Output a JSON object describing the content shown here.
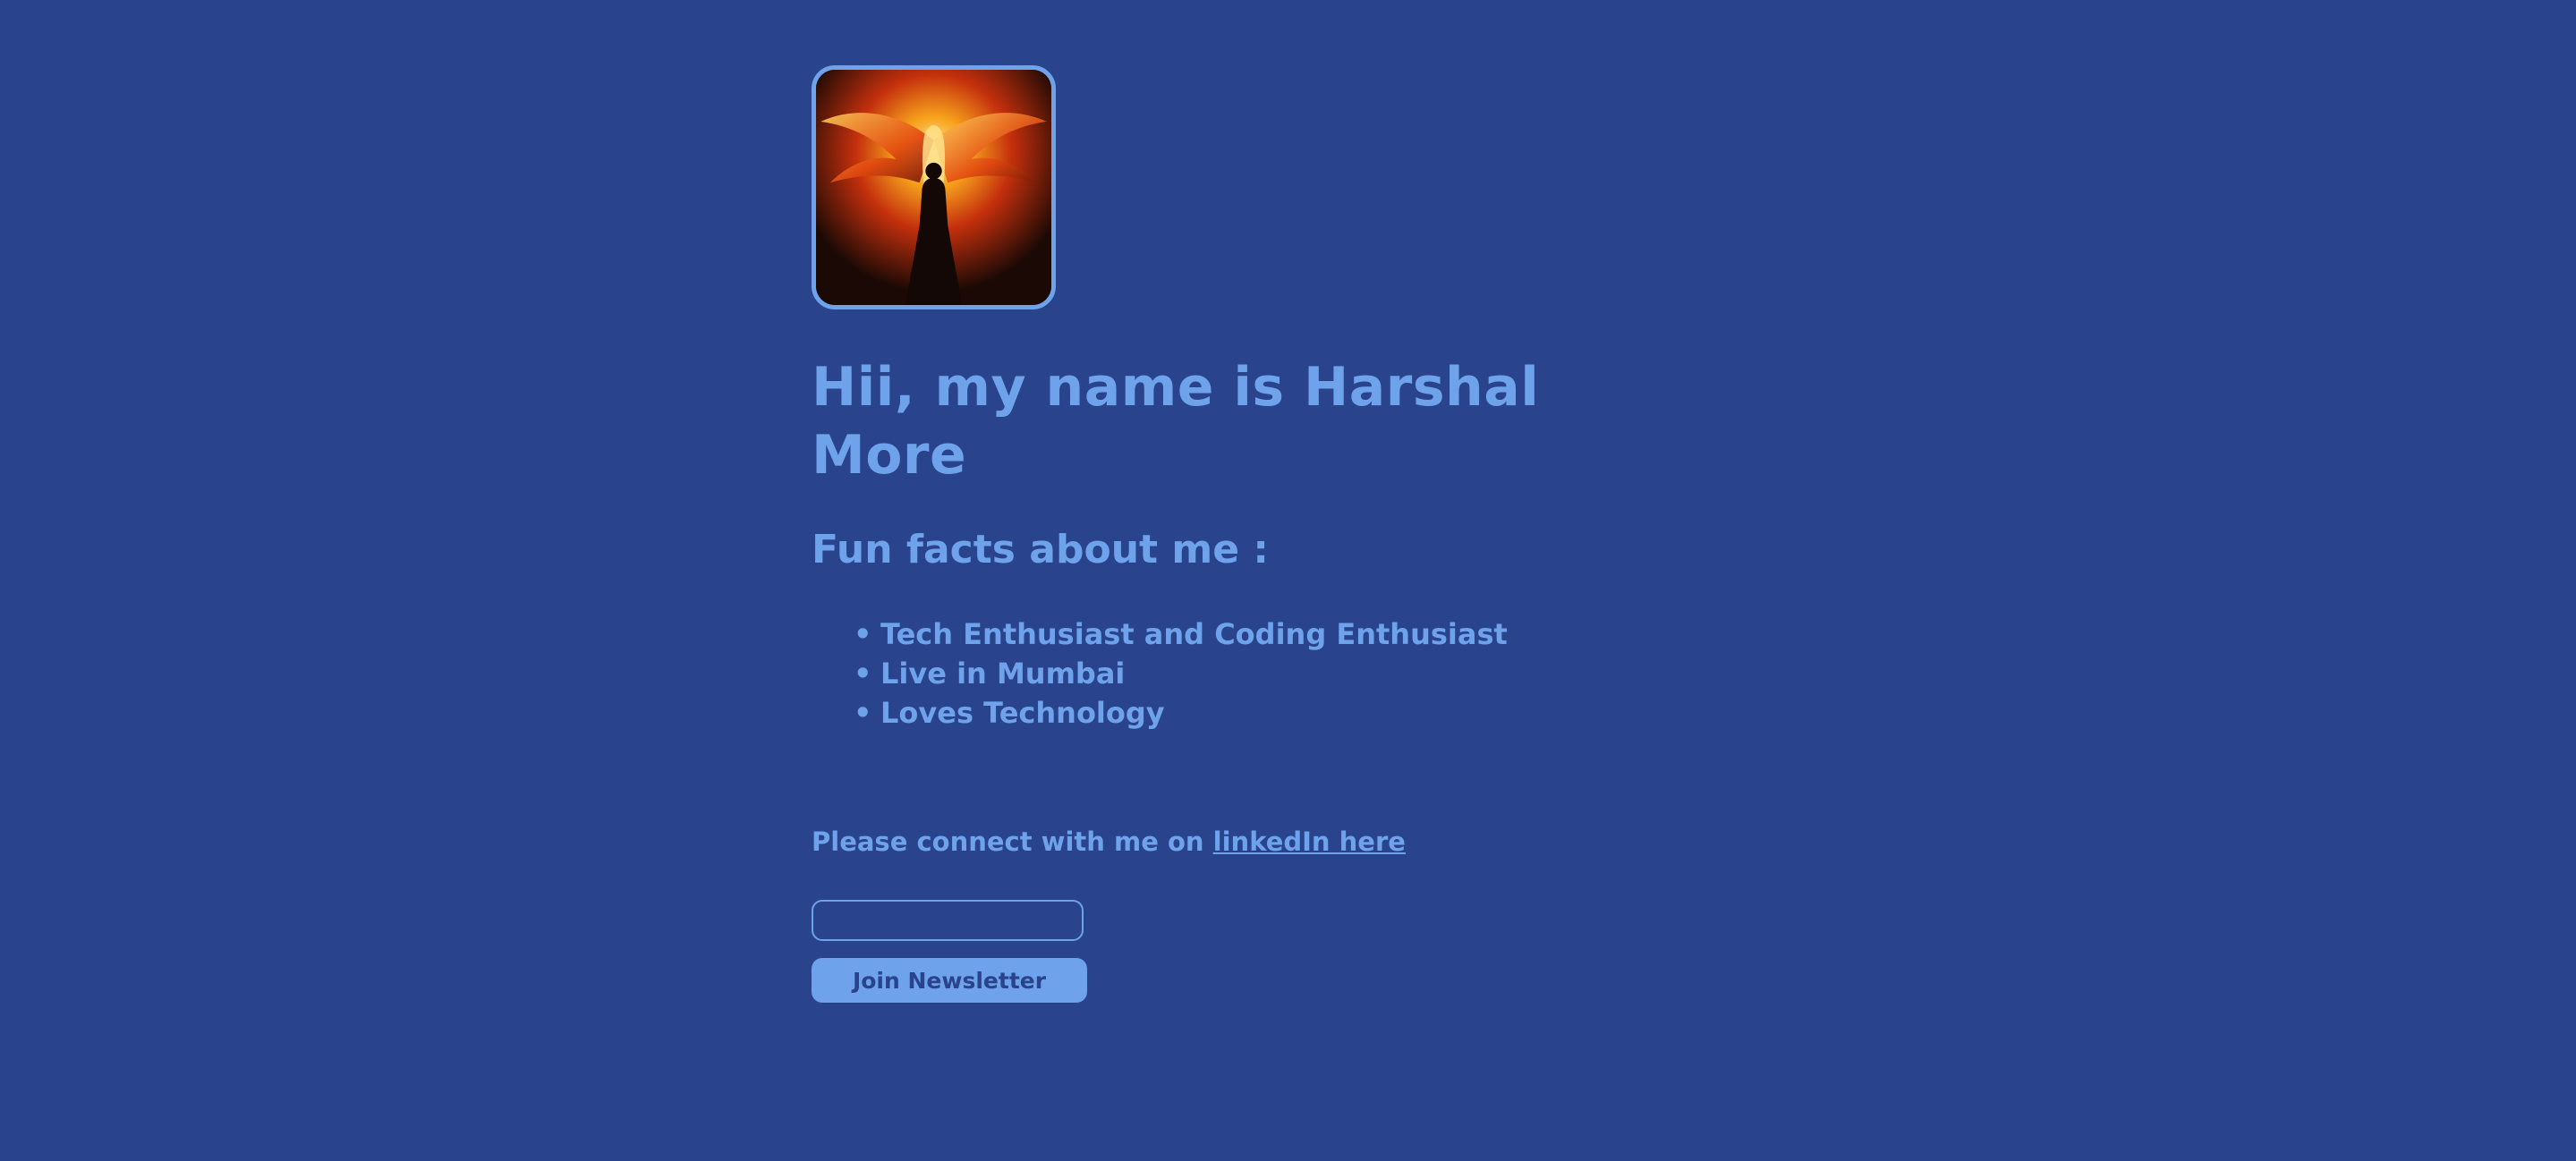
{
  "colors": {
    "background": "#29448c",
    "accent": "#6ea2ea"
  },
  "profile": {
    "image_icon": "phoenix-avatar-icon"
  },
  "heading": "Hii, my name is Harshal More",
  "fun_facts": {
    "title": "Fun facts about me :",
    "items": [
      "Tech Enthusiast and Coding Enthusiast",
      "Live in Mumbai",
      "Loves Technology"
    ]
  },
  "connect": {
    "text": "Please connect with me on ",
    "link_label": "linkedIn here"
  },
  "newsletter": {
    "input_value": "",
    "button_label": "Join Newsletter"
  }
}
